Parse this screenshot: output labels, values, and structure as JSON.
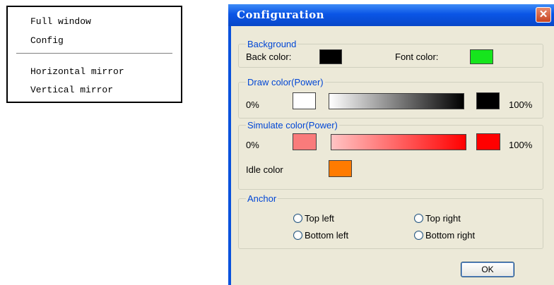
{
  "context_menu": {
    "items": [
      "Full window",
      "Config",
      "Horizontal mirror",
      "Vertical mirror"
    ]
  },
  "dialog": {
    "title": "Configuration",
    "close_glyph": "✕",
    "background_group": {
      "legend": "Background",
      "back_color_label": "Back color:",
      "back_color": "#000000",
      "font_color_label": "Font color:",
      "font_color": "#16e51d"
    },
    "draw_group": {
      "legend": "Draw color(Power)",
      "min_label": "0%",
      "max_label": "100%",
      "min_color": "#ffffff",
      "max_color": "#000000"
    },
    "simulate_group": {
      "legend": "Simulate color(Power)",
      "min_label": "0%",
      "max_label": "100%",
      "min_color": "#f97b7b",
      "max_color": "#ff0000",
      "idle_label": "Idle color",
      "idle_color": "#ff7b00"
    },
    "anchor_group": {
      "legend": "Anchor",
      "options": [
        "Top left",
        "Top right",
        "Bottom left",
        "Bottom right"
      ]
    },
    "ok_label": "OK"
  }
}
